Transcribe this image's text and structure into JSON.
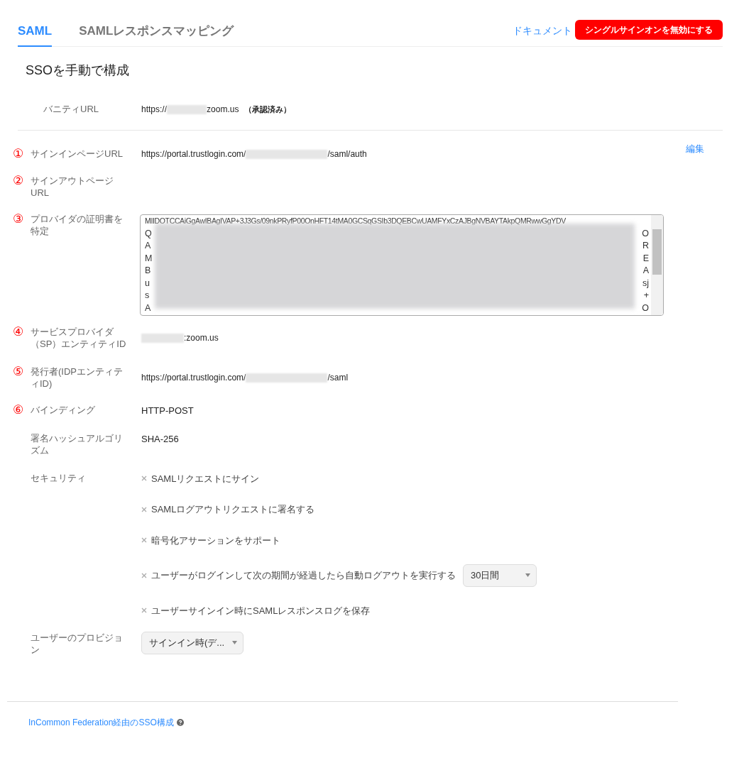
{
  "tabs": [
    {
      "label": "SAML",
      "selected": true
    },
    {
      "label": "SAMLレスポンスマッピング",
      "selected": false
    }
  ],
  "header_actions": {
    "doc_link": "ドキュメント",
    "disable_button": "シングルサインオンを無効にする"
  },
  "heading": "SSOを手動で構成",
  "vanity": {
    "label": "バニティURL",
    "value_start": "https://",
    "value_end": "zoom.us",
    "status": "（承認済み）"
  },
  "edit_link": "編集",
  "fields": [
    {
      "kind": "redacted_url",
      "number": "①",
      "label": "サインインページURL",
      "value_start": "https://portal.trustlogin.com/",
      "value_end": "/saml/auth"
    },
    {
      "kind": "empty",
      "number": "②",
      "label": "サインアウトページURL"
    },
    {
      "kind": "certificate",
      "number": "③",
      "label": "プロバイダの証明書を特定",
      "first_line": "MIIDOTCCAiGgAwIBAgIVAP+3J3Gs/09nkPRyfP00OnHFT14tMA0GCSqGSIb3DQEBCwUAMFYxCzAJBgNVBAYTAkpQMRwwGgYDV",
      "lines": [
        {
          "start": "Q",
          "end": "O"
        },
        {
          "start": "A",
          "end": "R"
        },
        {
          "start": "M",
          "end": "E"
        },
        {
          "start": "B",
          "end": "A"
        },
        {
          "start": "u",
          "end": "sj"
        },
        {
          "start": "s",
          "end": "+"
        },
        {
          "start": "A",
          "end": "O"
        }
      ]
    },
    {
      "kind": "redacted_url",
      "number": "④",
      "label": "サービスプロバイダ（SP）エンティティID",
      "value_end": ":zoom.us"
    },
    {
      "kind": "redacted_url",
      "number": "⑤",
      "label": "発行者(IDPエンティティID)",
      "value_start": "https://portal.trustlogin.com/",
      "value_end": "/saml"
    },
    {
      "kind": "text",
      "number": "⑥",
      "label": "バインディング",
      "value": "HTTP-POST"
    },
    {
      "kind": "text",
      "label": "署名ハッシュアルゴリズム",
      "value": "SHA-256"
    }
  ],
  "security": {
    "label": "セキュリティ",
    "options": [
      {
        "label": "SAMLリクエストにサイン",
        "checked": false
      },
      {
        "label": "SAMLログアウトリクエストに署名する",
        "checked": false
      },
      {
        "label": "暗号化アサーションをサポート",
        "checked": false
      },
      {
        "label": "ユーザーがログインして次の期間が経過したら自動ログアウトを実行する",
        "checked": false,
        "select": "30日間"
      },
      {
        "label": "ユーザーサインイン時にSAMLレスポンスログを保存",
        "checked": false
      }
    ]
  },
  "provisioning": {
    "label": "ユーザーのプロビジョン",
    "select": "サインイン時(デ..."
  },
  "footer_link": "InCommon Federation経由のSSO構成"
}
